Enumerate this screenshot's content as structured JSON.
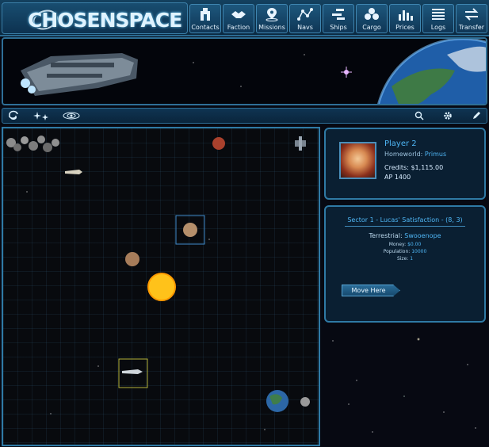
{
  "app": {
    "logo_text": "CHOSENSPACE"
  },
  "nav": [
    {
      "label": "Contacts",
      "icon": "contacts-icon"
    },
    {
      "label": "Faction",
      "icon": "handshake-icon"
    },
    {
      "label": "Missions",
      "icon": "map-pin-icon"
    },
    {
      "label": "Navs",
      "icon": "nav-route-icon"
    },
    {
      "label": "Ships",
      "icon": "ships-icon"
    },
    {
      "label": "Cargo",
      "icon": "cargo-icon"
    },
    {
      "label": "Prices",
      "icon": "bar-chart-icon"
    },
    {
      "label": "Logs",
      "icon": "logs-icon"
    },
    {
      "label": "Transfer",
      "icon": "transfer-icon"
    }
  ],
  "player": {
    "name": "Player 2",
    "homeworld_label": "Homeworld:",
    "homeworld": "Primus",
    "credits": "Credits: $1,115.00",
    "ap": "AP 1400"
  },
  "sector": {
    "title": "Sector 1 - Lucas' Satisfaction - (8, 3)",
    "terrestrial_label": "Terrestrial:",
    "terrestrial": "Swooenope",
    "money_label": "Money:",
    "money": "$0.00",
    "population_label": "Population:",
    "population": "10000",
    "size_label": "Size:",
    "size": "1",
    "move_button": "Move Here"
  },
  "colors": {
    "accent": "#4fb6f5",
    "border": "#2f7aa5",
    "panel_bg": "#0a2034"
  }
}
